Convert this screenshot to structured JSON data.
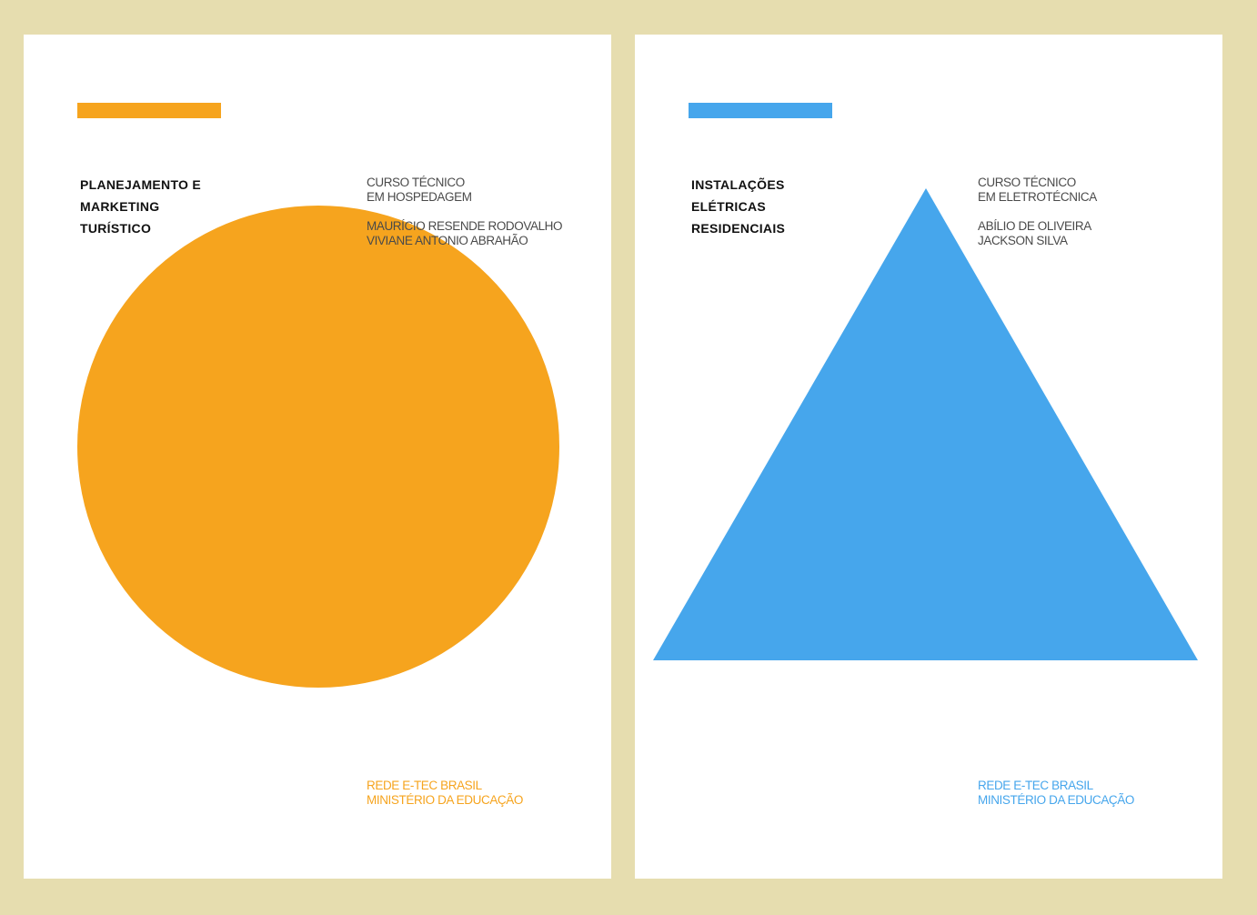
{
  "colors": {
    "background": "#e6ddaf",
    "left_accent": "#f6a41e",
    "right_accent": "#46a6ec"
  },
  "covers": [
    {
      "title_lines": [
        "PLANEJAMENTO E",
        "MARKETING",
        "TURÍSTICO"
      ],
      "course_lines": [
        "CURSO TÉCNICO",
        "EM HOSPEDAGEM"
      ],
      "author_lines": [
        "MAURÍCIO RESENDE RODOVALHO",
        "VIVIANE ANTONIO ABRAHÃO"
      ],
      "footer_lines": [
        "REDE E-TEC BRASIL",
        "MINISTÉRIO DA EDUCAÇÃO"
      ],
      "shape": "circle"
    },
    {
      "title_lines": [
        "INSTALAÇÕES",
        "ELÉTRICAS",
        "RESIDENCIAIS"
      ],
      "course_lines": [
        "CURSO TÉCNICO",
        "EM ELETROTÉCNICA"
      ],
      "author_lines": [
        "ABÍLIO DE OLIVEIRA",
        "JACKSON SILVA"
      ],
      "footer_lines": [
        "REDE E-TEC BRASIL",
        "MINISTÉRIO DA EDUCAÇÃO"
      ],
      "shape": "triangle"
    }
  ]
}
